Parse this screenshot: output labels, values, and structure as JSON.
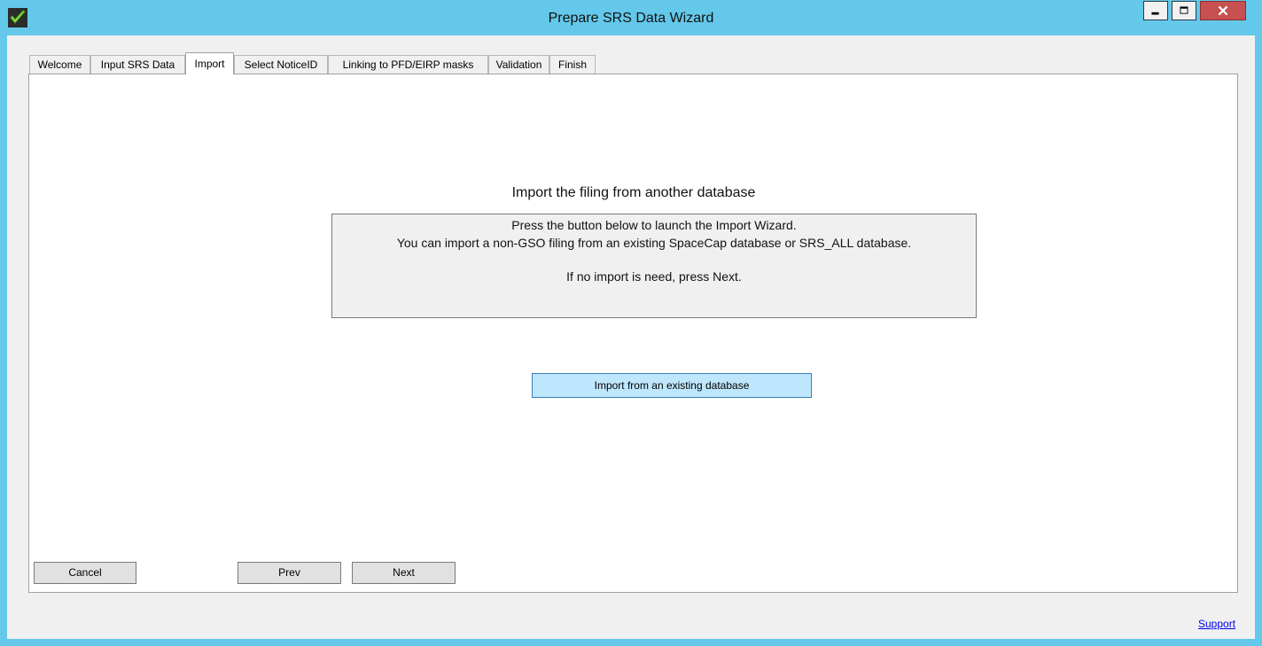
{
  "window": {
    "title": "Prepare SRS Data Wizard",
    "controls": {
      "minimize": "minimize",
      "maximize": "maximize",
      "close": "close"
    }
  },
  "tabs": [
    {
      "label": "Welcome"
    },
    {
      "label": "Input SRS Data"
    },
    {
      "label": "Import",
      "active": true
    },
    {
      "label": "Select NoticeID"
    },
    {
      "label": "Linking to PFD/EIRP masks"
    },
    {
      "label": "Validation"
    },
    {
      "label": "Finish"
    }
  ],
  "import_page": {
    "heading": "Import the filing from another database",
    "info_lines": [
      "Press the button below to launch the Import Wizard.",
      "You can import a non-GSO filing from an existing SpaceCap database or SRS_ALL database.",
      "If no import is need, press Next."
    ],
    "import_button": "Import from an existing database"
  },
  "footer": {
    "cancel": "Cancel",
    "prev": "Prev",
    "next": "Next",
    "support": "Support"
  },
  "colors": {
    "titlebar": "#64c8ea",
    "close_button": "#c75050",
    "highlight_button": "#bee6fd",
    "link": "#0000ee"
  }
}
